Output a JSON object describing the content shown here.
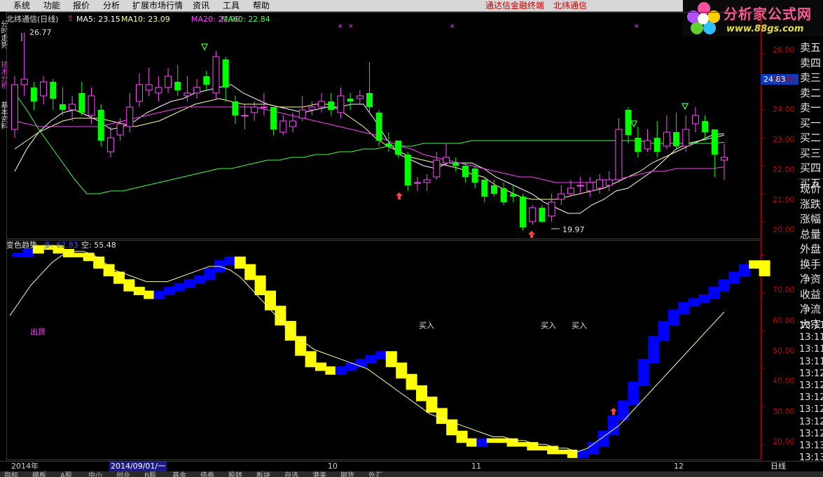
{
  "menu": {
    "items": [
      "系统",
      "功能",
      "报价",
      "分析",
      "扩展市场行情",
      "资讯",
      "工具",
      "帮助"
    ],
    "right_links": [
      "通达信金融终端",
      "北纬通信"
    ]
  },
  "logo": {
    "title": "分析家公式网",
    "url": "www.88gs.com"
  },
  "left_tabs": [
    "分时走势",
    "技术分析",
    "基本资料"
  ],
  "price_panel": {
    "title": "北纬通信(日线)",
    "ma5": "MA5: 23.15",
    "ma10": "MA10: 23.09",
    "ma20": "MA20: 21.96",
    "ma60": "MA60: 22.84",
    "high_label": "26.77",
    "low_label": "19.97",
    "current_price": "24.83",
    "ticks": [
      "26.00",
      "25.00",
      "24.00",
      "23.00",
      "22.00",
      "21.00",
      "20.00"
    ]
  },
  "indicator_panel": {
    "title": "变色趋势",
    "duo": "多: 62.83",
    "kong": "空: 55.48",
    "sell_label": "出货",
    "buy_labels": [
      "买入",
      "买入",
      "买入"
    ],
    "ticks": [
      "70.00",
      "60.00",
      "50.00",
      "40.00",
      "30.00",
      "20.00"
    ]
  },
  "timebar": {
    "year": "2014年",
    "date": "2014/09/01/一",
    "m10": "10",
    "m11": "11",
    "m12": "12",
    "period": "日线"
  },
  "sidebar": {
    "book": [
      "卖五",
      "卖四",
      "卖三",
      "卖二",
      "卖一",
      "买一",
      "买二",
      "买三",
      "买四",
      "买五"
    ],
    "stats": [
      "现价",
      "涨跌",
      "涨幅",
      "总量",
      "外盘",
      "换手",
      "净资",
      "收益",
      "净流",
      "大宗"
    ],
    "times": [
      "13:11",
      "13:11",
      "13:11",
      "13:11",
      "13:12",
      "13:12",
      "13:12",
      "13:12",
      "13:12",
      "13:12",
      "13:13",
      "13:13"
    ]
  },
  "bottombar": {
    "tabs": [
      "指标",
      "模板",
      "A股",
      "中小",
      "创业",
      "B股",
      "基金",
      "债券",
      "股转",
      "板块",
      "自选",
      "港美",
      "期货",
      "外汇"
    ]
  },
  "colors": {
    "up": "#ff4bff",
    "down": "#00ff00",
    "ma5": "#ffffff",
    "ma10": "#ffff99",
    "ma20": "#ff40ff",
    "ma60": "#40ff40",
    "axis": "#c00000",
    "duo": "#0000ff",
    "kong": "#ffff00"
  },
  "chart_data": [
    {
      "type": "candlestick",
      "title": "北纬通信(日线)",
      "ylim": [
        19.6,
        27.0
      ],
      "series": [
        {
          "name": "MA5",
          "values": [
            21.8,
            22.6,
            23.2,
            23.6,
            23.9,
            24.0,
            23.8,
            23.6,
            23.3,
            23.4,
            23.6,
            23.9,
            24.1,
            24.3,
            24.4,
            24.6,
            24.7,
            24.8,
            24.9,
            24.6,
            24.4,
            24.2,
            24.1,
            24.0,
            23.9,
            24.0,
            24.1,
            24.1,
            24.2,
            24.2,
            23.6,
            22.9,
            22.4,
            22.2,
            22.0,
            21.9,
            22.1,
            22.1,
            22.1,
            21.9,
            21.6,
            21.4,
            21.2,
            21.0,
            20.7,
            20.5,
            20.3,
            20.3,
            20.6,
            20.8,
            21.1,
            21.2,
            21.5,
            21.8,
            22.2,
            22.6,
            22.8,
            22.9,
            23.1,
            23.15
          ]
        },
        {
          "name": "MA10",
          "values": [
            22.6,
            22.9,
            23.2,
            23.4,
            23.6,
            23.7,
            23.7,
            23.7,
            23.6,
            23.5,
            23.4,
            23.5,
            23.6,
            23.8,
            24.0,
            24.2,
            24.3,
            24.4,
            24.3,
            24.2,
            24.2,
            24.2,
            24.1,
            24.1,
            24.1,
            24.2,
            24.2,
            24.0,
            23.7,
            23.4,
            23.0,
            22.7,
            22.5,
            22.3,
            22.2,
            22.1,
            22.0,
            21.9,
            21.7,
            21.6,
            21.3,
            21.1,
            20.9,
            20.8,
            20.8,
            20.8,
            20.9,
            21.0,
            21.1,
            21.2,
            21.4,
            21.6,
            21.8,
            22.1,
            22.3,
            22.5,
            22.7,
            22.9,
            23.0,
            23.09
          ]
        },
        {
          "name": "MA20",
          "values": [
            23.6,
            23.5,
            23.4,
            23.4,
            23.4,
            23.4,
            23.4,
            23.4,
            23.5,
            23.6,
            23.7,
            23.8,
            23.9,
            24.0,
            24.1,
            24.1,
            24.1,
            24.1,
            24.1,
            24.1,
            24.1,
            24.0,
            23.9,
            23.8,
            23.7,
            23.6,
            23.5,
            23.4,
            23.3,
            23.2,
            23.1,
            22.9,
            22.7,
            22.6,
            22.4,
            22.3,
            22.2,
            22.1,
            22.0,
            21.9,
            21.8,
            21.7,
            21.6,
            21.6,
            21.5,
            21.4,
            21.4,
            21.4,
            21.4,
            21.5,
            21.5,
            21.6,
            21.7,
            21.8,
            21.8,
            21.9,
            21.9,
            21.9,
            21.9,
            21.96
          ]
        },
        {
          "name": "MA60",
          "values": [
            24.6,
            24.0,
            23.3,
            22.7,
            22.1,
            21.5,
            21.0,
            21.0,
            21.1,
            21.1,
            21.2,
            21.3,
            21.4,
            21.5,
            21.6,
            21.7,
            21.8,
            21.9,
            21.9,
            22.0,
            22.1,
            22.2,
            22.2,
            22.3,
            22.3,
            22.4,
            22.4,
            22.5,
            22.5,
            22.6,
            22.6,
            22.7,
            22.7,
            22.7,
            22.8,
            22.8,
            22.8,
            22.8,
            22.9,
            22.9,
            22.9,
            22.9,
            22.9,
            22.9,
            22.9,
            22.9,
            22.9,
            22.9,
            22.9,
            22.9,
            22.9,
            22.9,
            22.9,
            22.8,
            22.8,
            22.8,
            22.8,
            22.8,
            22.8,
            22.84
          ]
        }
      ],
      "candles": [
        [
          23.3,
          24.9,
          25.2,
          23.0
        ],
        [
          24.9,
          25.1,
          26.77,
          24.5
        ],
        [
          24.8,
          24.3,
          25.0,
          24.0
        ],
        [
          24.5,
          25.0,
          25.2,
          24.2
        ],
        [
          25.0,
          24.4,
          25.1,
          24.0
        ],
        [
          24.2,
          24.0,
          24.8,
          23.8
        ],
        [
          24.0,
          24.2,
          24.5,
          23.6
        ],
        [
          24.6,
          23.9,
          25.0,
          23.8
        ],
        [
          23.8,
          24.5,
          24.8,
          23.5
        ],
        [
          24.0,
          22.9,
          24.2,
          22.7
        ],
        [
          22.5,
          23.0,
          23.4,
          22.3
        ],
        [
          23.1,
          23.5,
          23.7,
          22.9
        ],
        [
          23.4,
          24.1,
          24.6,
          23.2
        ],
        [
          24.3,
          24.9,
          25.3,
          24.1
        ],
        [
          24.7,
          24.9,
          25.5,
          24.5
        ],
        [
          24.6,
          24.8,
          25.2,
          24.3
        ],
        [
          24.8,
          25.2,
          25.5,
          24.6
        ],
        [
          25.0,
          24.7,
          25.6,
          24.5
        ],
        [
          24.5,
          24.6,
          25.2,
          24.3
        ],
        [
          24.6,
          24.8,
          25.1,
          24.4
        ],
        [
          25.2,
          24.9,
          25.4,
          24.7
        ],
        [
          24.6,
          25.9,
          26.1,
          24.4
        ],
        [
          25.8,
          24.8,
          25.9,
          24.3
        ],
        [
          24.3,
          23.8,
          24.5,
          23.5
        ],
        [
          23.8,
          23.8,
          24.2,
          23.3
        ],
        [
          23.9,
          24.1,
          24.3,
          23.6
        ],
        [
          24.1,
          24.1,
          24.6,
          23.8
        ],
        [
          24.1,
          23.3,
          24.1,
          23.1
        ],
        [
          23.2,
          23.6,
          23.8,
          23.1
        ],
        [
          23.4,
          23.6,
          23.9,
          23.2
        ],
        [
          23.7,
          24.0,
          24.5,
          23.6
        ],
        [
          24.0,
          24.1,
          24.3,
          23.8
        ],
        [
          24.1,
          24.3,
          24.6,
          23.9
        ],
        [
          24.3,
          24.0,
          24.6,
          23.8
        ],
        [
          23.9,
          24.5,
          24.8,
          23.7
        ],
        [
          24.4,
          24.3,
          24.6,
          24.0
        ],
        [
          24.4,
          24.5,
          24.7,
          24.2
        ],
        [
          24.6,
          24.1,
          25.7,
          23.9
        ],
        [
          23.9,
          22.9,
          24.0,
          22.7
        ],
        [
          22.8,
          22.7,
          23.2,
          22.5
        ],
        [
          22.9,
          22.4,
          22.9,
          22.3
        ],
        [
          22.4,
          21.3,
          22.5,
          21.1
        ],
        [
          21.4,
          21.4,
          21.6,
          21.1
        ],
        [
          21.4,
          21.5,
          21.7,
          21.1
        ],
        [
          21.6,
          22.2,
          22.5,
          21.5
        ],
        [
          22.1,
          22.3,
          22.8,
          22.0
        ],
        [
          22.1,
          22.0,
          22.3,
          21.8
        ],
        [
          22.0,
          21.6,
          22.1,
          21.4
        ],
        [
          21.9,
          21.4,
          22.0,
          21.2
        ],
        [
          21.5,
          20.9,
          21.6,
          20.7
        ],
        [
          21.3,
          21.0,
          21.5,
          20.9
        ],
        [
          21.2,
          20.7,
          21.4,
          20.6
        ],
        [
          21.0,
          20.9,
          21.3,
          20.7
        ],
        [
          20.9,
          19.8,
          21.0,
          19.7
        ],
        [
          20.0,
          20.5,
          20.6,
          19.9
        ],
        [
          20.5,
          20.0,
          20.6,
          19.97
        ],
        [
          20.2,
          20.7,
          21.0,
          20.0
        ],
        [
          20.8,
          21.0,
          21.3,
          20.6
        ],
        [
          21.0,
          21.2,
          21.5,
          20.9
        ],
        [
          21.3,
          21.3,
          21.6,
          21.0
        ],
        [
          21.1,
          21.4,
          21.6,
          20.9
        ],
        [
          21.2,
          21.5,
          21.7,
          21.0
        ],
        [
          21.3,
          21.5,
          21.8,
          21.1
        ],
        [
          21.5,
          23.3,
          23.7,
          21.4
        ],
        [
          24.0,
          23.1,
          24.1,
          22.8
        ],
        [
          23.0,
          22.5,
          23.4,
          22.3
        ],
        [
          22.6,
          22.9,
          23.3,
          22.5
        ],
        [
          23.0,
          22.5,
          23.6,
          22.3
        ],
        [
          22.7,
          23.2,
          23.8,
          22.6
        ],
        [
          23.2,
          22.7,
          23.9,
          22.6
        ],
        [
          22.7,
          23.3,
          23.8,
          22.5
        ],
        [
          23.5,
          23.8,
          24.1,
          23.2
        ],
        [
          23.6,
          23.2,
          23.8,
          22.9
        ],
        [
          23.3,
          22.4,
          23.3,
          21.6
        ],
        [
          22.2,
          22.3,
          22.8,
          21.5
        ]
      ]
    },
    {
      "type": "bar",
      "title": "变色趋势",
      "ylim": [
        16,
        74
      ],
      "series": [
        {
          "name": "多",
          "values": [
            62.83
          ]
        },
        {
          "name": "空",
          "values": [
            55.48
          ]
        }
      ]
    }
  ]
}
